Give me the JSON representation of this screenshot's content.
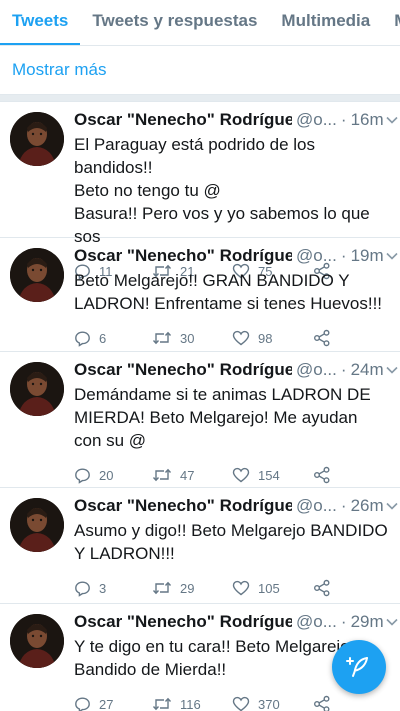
{
  "tabs": [
    {
      "label": "Tweets",
      "active": true
    },
    {
      "label": "Tweets y respuestas",
      "active": false
    },
    {
      "label": "Multimedia",
      "active": false
    },
    {
      "label": "M",
      "active": false
    }
  ],
  "show_more": "Mostrar más",
  "colors": {
    "accent": "#1da1f2",
    "secondary_text": "#657786",
    "divider": "#e1e8ed"
  },
  "tweets": [
    {
      "name": "Oscar \"Nenecho\" Rodríguez",
      "handle": "@o...",
      "dot": "·",
      "time": "16m",
      "text": "El Paraguay está podrido de los bandidos!!\nBeto no tengo tu @\nBasura!! Pero vos y yo sabemos lo que sos",
      "replies": "11",
      "retweets": "21",
      "likes": "75"
    },
    {
      "name": "Oscar \"Nenecho\" Rodríguez",
      "handle": "@o...",
      "dot": "·",
      "time": "19m",
      "text": "Beto Melgarejo!! GRAN BANDIDO Y LADRON! Enfrentame si tenes Huevos!!!",
      "replies": "6",
      "retweets": "30",
      "likes": "98"
    },
    {
      "name": "Oscar \"Nenecho\" Rodríguez",
      "handle": "@o...",
      "dot": "·",
      "time": "24m",
      "text": "Demándame si te animas LADRON DE MIERDA! Beto Melgarejo! Me ayudan con su @",
      "replies": "20",
      "retweets": "47",
      "likes": "154"
    },
    {
      "name": "Oscar \"Nenecho\" Rodríguez",
      "handle": "@o...",
      "dot": "·",
      "time": "26m",
      "text": "Asumo y digo!! Beto Melgarejo BANDIDO Y LADRON!!!",
      "replies": "3",
      "retweets": "29",
      "likes": "105"
    },
    {
      "name": "Oscar \"Nenecho\" Rodríguez",
      "handle": "@o...",
      "dot": "·",
      "time": "29m",
      "text": "Y te digo en tu cara!! Beto Melgarejo Bandido de Mierda!!",
      "replies": "27",
      "retweets": "116",
      "likes": "370"
    }
  ],
  "icons": {
    "reply": "speech-bubble-icon",
    "retweet": "retweet-arrows-icon",
    "like": "heart-outline-icon",
    "share": "share-nodes-icon",
    "menu": "chevron-down-icon",
    "compose": "compose-feather-icon"
  }
}
